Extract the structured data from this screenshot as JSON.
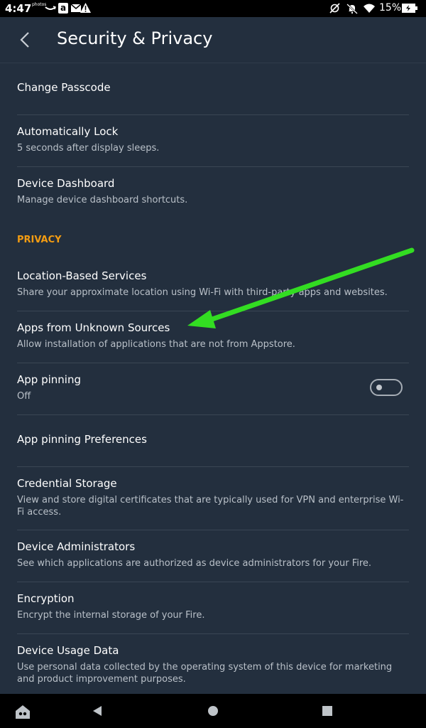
{
  "status_bar": {
    "time": "4:47",
    "photos_label": "photos",
    "amazon_label": "a",
    "battery": "15%"
  },
  "header": {
    "title": "Security & Privacy"
  },
  "rows": [
    {
      "title": "Change Passcode",
      "subtitle": ""
    },
    {
      "title": "Automatically Lock",
      "subtitle": "5 seconds after display sleeps."
    },
    {
      "title": "Device Dashboard",
      "subtitle": "Manage device dashboard shortcuts."
    },
    {
      "title": "Location-Based Services",
      "subtitle": "Share your approximate location using Wi-Fi with third-party apps and websites."
    },
    {
      "title": "Apps from Unknown Sources",
      "subtitle": "Allow installation of applications that are not from Appstore."
    },
    {
      "title": "App pinning",
      "subtitle": "Off"
    },
    {
      "title": "App pinning Preferences",
      "subtitle": ""
    },
    {
      "title": "Credential Storage",
      "subtitle": "View and store digital certificates that are typically used for VPN and enterprise Wi-Fi access."
    },
    {
      "title": "Device Administrators",
      "subtitle": "See which applications are authorized as device administrators for your Fire."
    },
    {
      "title": "Encryption",
      "subtitle": "Encrypt the internal storage of your Fire."
    },
    {
      "title": "Device Usage Data",
      "subtitle": "Use personal data collected by the operating system of this device for marketing and product improvement purposes."
    }
  ],
  "section_privacy": "PRIVACY",
  "app_pinning_toggle": {
    "on": false
  },
  "colors": {
    "background": "#232f3e",
    "section_accent": "#f39c12",
    "annotation_arrow": "#33dd22"
  },
  "icons": {
    "back": "back-arrow-icon",
    "nav_home": "home-icon",
    "nav_back": "back-triangle-icon",
    "nav_circle": "circle-home-icon",
    "nav_recents": "recents-square-icon"
  }
}
